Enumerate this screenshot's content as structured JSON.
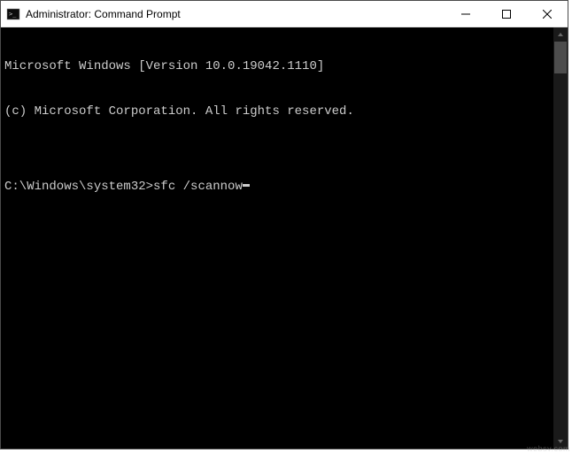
{
  "titlebar": {
    "title": "Administrator: Command Prompt"
  },
  "console": {
    "line1": "Microsoft Windows [Version 10.0.19042.1110]",
    "line2": "(c) Microsoft Corporation. All rights reserved.",
    "blank": "",
    "prompt": "C:\\Windows\\system32>",
    "command": "sfc /scannow"
  },
  "watermark": "websv.com"
}
